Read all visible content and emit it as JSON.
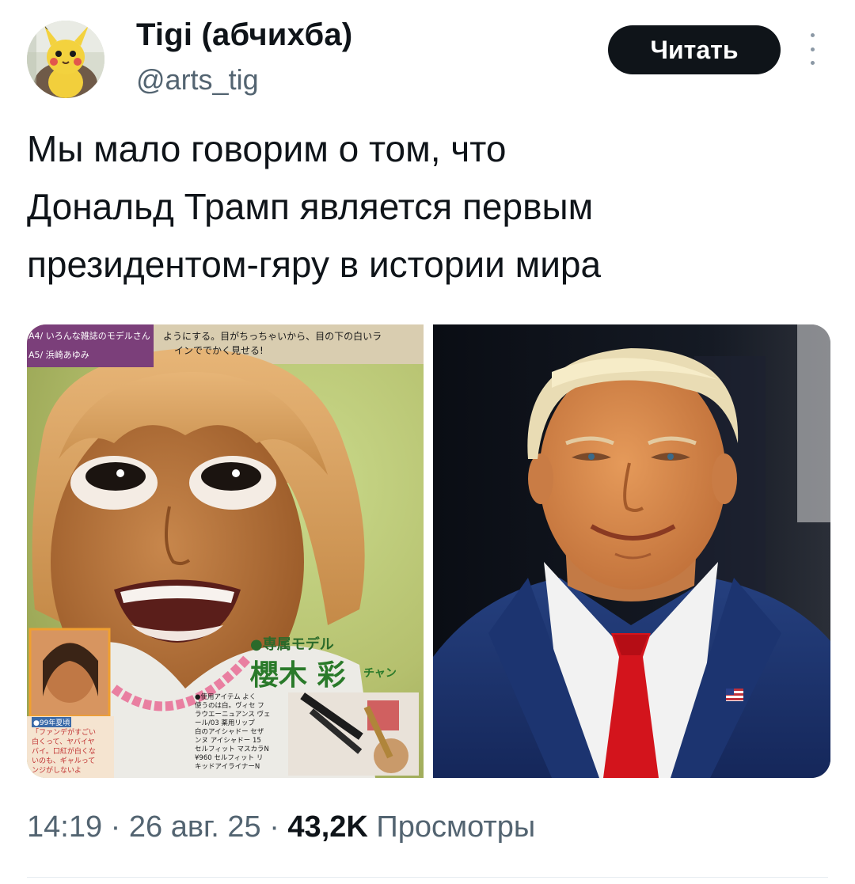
{
  "author": {
    "display_name": "Tigi (абчихба)",
    "handle": "@arts_tig",
    "avatar_icon": "pikachu-plush-avatar"
  },
  "actions": {
    "follow_label": "Читать",
    "more_icon": "vertical-ellipsis-icon"
  },
  "tweet": {
    "lines": [
      "Мы мало говорим о том, что",
      "Дональд Трамп является первым",
      "президентом-гяру в истории мира"
    ]
  },
  "media": {
    "left_magazine": {
      "tag_a4": "A4/ いろんな雑誌のモデルさん",
      "tag_a5": "A5/ 浜崎あゆみ",
      "headline_1": "ようにする。目がちっちゃいから、目の下の白いラ",
      "headline_2": "インででかく見せる!",
      "model_label": "●専属モデル",
      "model_name": "櫻木 彩",
      "model_suffix": "チャン",
      "year_label": "●99年夏頃",
      "caption_lines": [
        "「ファンデがすごい",
        "白くって、ヤバイヤ",
        "バイ。口紅が白くな",
        "いのも、ギャルって",
        "ンジがしないよ"
      ],
      "items_lines": [
        "●使用アイテム よく",
        "使うのは白。ヴィセ フ",
        "ラウエーニュアンス ヴェ",
        "ール/03 薬用リップ",
        "白のアイシャドー セザ",
        "ンヌ アイシャドー 15",
        "セルフィット マスカラN",
        "¥960 セルフィット リ",
        "キッドアイライナーN"
      ]
    }
  },
  "meta": {
    "time": "14:19",
    "separator": "·",
    "date": "26 авг. 25",
    "views_count": "43,2K",
    "views_label": "Просмотры"
  },
  "colors": {
    "follow_bg": "#0f1419",
    "secondary_text": "#536471",
    "suit_navy": "#1f3470",
    "tie_red": "#d3141c"
  }
}
